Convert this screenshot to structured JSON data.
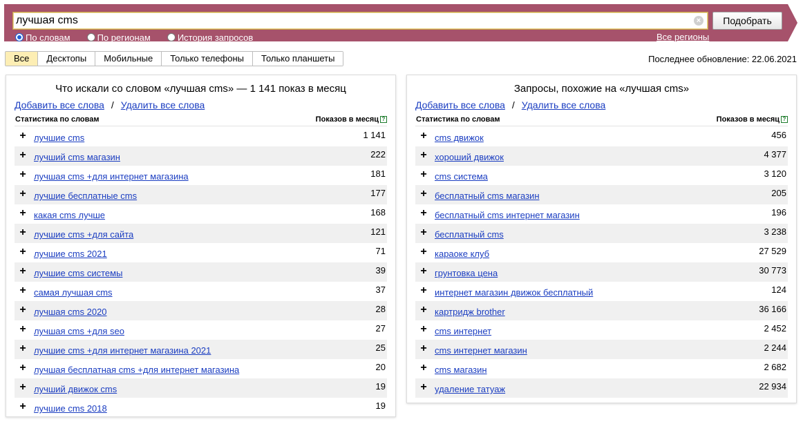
{
  "search": {
    "query": "лучшая cms",
    "submit_label": "Подобрать",
    "clear_glyph": "×",
    "modes": [
      {
        "label": "По словам",
        "checked": true
      },
      {
        "label": "По регионам",
        "checked": false
      },
      {
        "label": "История запросов",
        "checked": false
      }
    ],
    "regions_link": "Все регионы"
  },
  "device_tabs": [
    {
      "label": "Все",
      "active": true
    },
    {
      "label": "Десктопы",
      "active": false
    },
    {
      "label": "Мобильные",
      "active": false
    },
    {
      "label": "Только телефоны",
      "active": false
    },
    {
      "label": "Только планшеты",
      "active": false
    }
  ],
  "last_update": "Последнее обновление: 22.06.2021",
  "left_panel": {
    "title": "Что искали со словом «лучшая cms» — 1 141 показ в месяц",
    "add_all": "Добавить все слова",
    "separator": "/",
    "remove_all": "Удалить все слова",
    "col_words": "Статистика по словам",
    "col_count": "Показов в месяц",
    "help_glyph": "?",
    "rows": [
      {
        "keyword": "лучшие cms",
        "count": "1 141"
      },
      {
        "keyword": "лучший cms магазин",
        "count": "222"
      },
      {
        "keyword": "лучшая cms +для интернет магазина",
        "count": "181"
      },
      {
        "keyword": "лучшие бесплатные cms",
        "count": "177"
      },
      {
        "keyword": "какая cms лучше",
        "count": "168"
      },
      {
        "keyword": "лучшие cms +для сайта",
        "count": "121"
      },
      {
        "keyword": "лучшие cms 2021",
        "count": "71"
      },
      {
        "keyword": "лучшие cms системы",
        "count": "39"
      },
      {
        "keyword": "самая лучшая cms",
        "count": "37"
      },
      {
        "keyword": "лучшая cms 2020",
        "count": "28"
      },
      {
        "keyword": "лучшая cms +для seo",
        "count": "27"
      },
      {
        "keyword": "лучшие cms +для интернет магазина 2021",
        "count": "25"
      },
      {
        "keyword": "лучшая бесплатная cms +для интернет магазина",
        "count": "20"
      },
      {
        "keyword": "лучший движок cms",
        "count": "19"
      },
      {
        "keyword": "лучшие cms 2018",
        "count": "19"
      }
    ]
  },
  "right_panel": {
    "title": "Запросы, похожие на «лучшая cms»",
    "add_all": "Добавить все слова",
    "separator": "/",
    "remove_all": "Удалить все слова",
    "col_words": "Статистика по словам",
    "col_count": "Показов в месяц",
    "help_glyph": "?",
    "rows": [
      {
        "keyword": "cms движок",
        "count": "456"
      },
      {
        "keyword": "хороший движок",
        "count": "4 377"
      },
      {
        "keyword": "cms система",
        "count": "3 120"
      },
      {
        "keyword": "бесплатный cms магазин",
        "count": "205"
      },
      {
        "keyword": "бесплатный cms интернет магазин",
        "count": "196"
      },
      {
        "keyword": "бесплатный cms",
        "count": "3 238"
      },
      {
        "keyword": "караоке клуб",
        "count": "27 529"
      },
      {
        "keyword": "грунтовка цена",
        "count": "30 773"
      },
      {
        "keyword": "интернет магазин движок бесплатный",
        "count": "124"
      },
      {
        "keyword": "картридж brother",
        "count": "36 166"
      },
      {
        "keyword": "cms интернет",
        "count": "2 452"
      },
      {
        "keyword": "cms интернет магазин",
        "count": "2 244"
      },
      {
        "keyword": "cms магазин",
        "count": "2 682"
      },
      {
        "keyword": "удаление татуаж",
        "count": "22 934"
      }
    ]
  },
  "icons": {
    "plus": "plus-icon",
    "clear": "clear-icon",
    "help": "help-icon"
  },
  "colors": {
    "header": "#a6526b",
    "link": "#1a3dc1",
    "active_tab": "#fdeeb4",
    "row_stripe": "#f0f0f0"
  }
}
